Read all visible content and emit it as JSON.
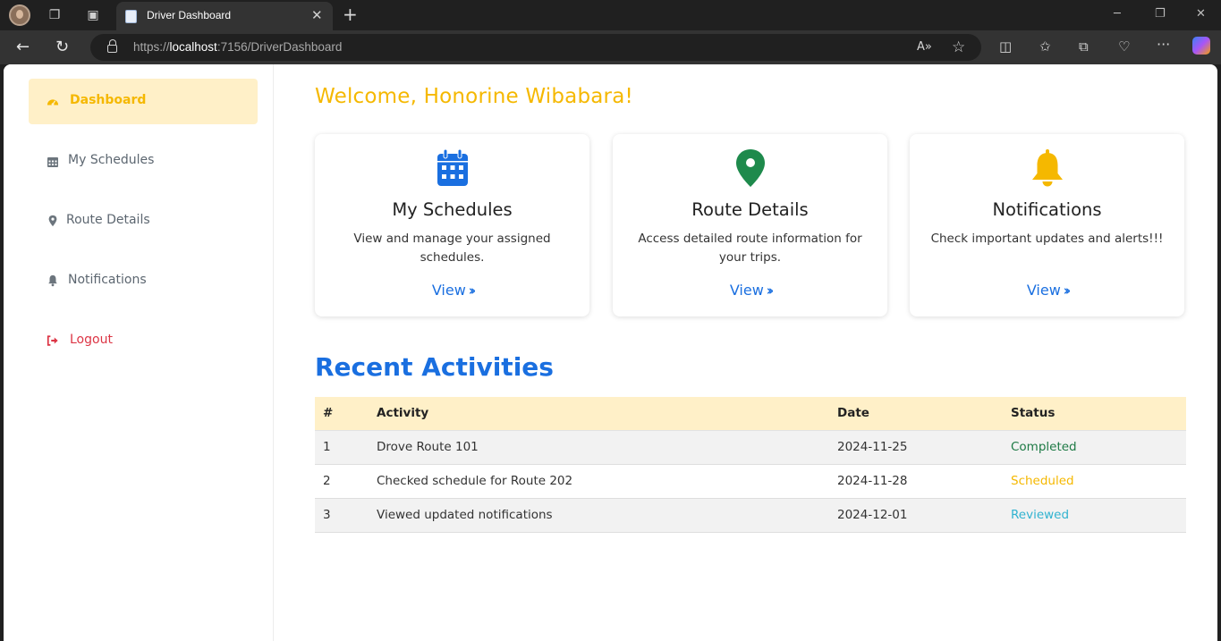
{
  "browser": {
    "tab_title": "Driver Dashboard",
    "url_prefix": "https://",
    "url_host": "localhost",
    "url_path": ":7156/DriverDashboard"
  },
  "sidebar": {
    "items": [
      {
        "label": "Dashboard",
        "icon": "gauge-icon"
      },
      {
        "label": "My Schedules",
        "icon": "calendar-icon"
      },
      {
        "label": "Route Details",
        "icon": "map-pin-icon"
      },
      {
        "label": "Notifications",
        "icon": "bell-icon"
      },
      {
        "label": "Logout",
        "icon": "logout-icon"
      }
    ]
  },
  "main": {
    "welcome": "Welcome, Honorine Wibabara!",
    "cards": [
      {
        "title": "My Schedules",
        "desc": "View and manage your assigned schedules.",
        "link": "View",
        "icon": "calendar-icon",
        "icon_color": "#1a6fe0"
      },
      {
        "title": "Route Details",
        "desc": "Access detailed route information for your trips.",
        "link": "View",
        "icon": "map-pin-icon",
        "icon_color": "#1e8a4c"
      },
      {
        "title": "Notifications",
        "desc": "Check important updates and alerts!!!",
        "link": "View",
        "icon": "bell-icon",
        "icon_color": "#f5b800"
      }
    ],
    "recent_title": "Recent Activities",
    "table": {
      "headers": [
        "#",
        "Activity",
        "Date",
        "Status"
      ],
      "rows": [
        {
          "num": "1",
          "activity": "Drove Route 101",
          "date": "2024-11-25",
          "status": "Completed",
          "status_color": "#1e7a45"
        },
        {
          "num": "2",
          "activity": "Checked schedule for Route 202",
          "date": "2024-11-28",
          "status": "Scheduled",
          "status_color": "#f5b800"
        },
        {
          "num": "3",
          "activity": "Viewed updated notifications",
          "date": "2024-12-01",
          "status": "Reviewed",
          "status_color": "#31b3d0"
        }
      ]
    }
  },
  "colors": {
    "accent_yellow": "#f5b800",
    "accent_blue": "#1a6fe0",
    "active_bg": "#fff0c8",
    "logout_red": "#dc3545"
  }
}
